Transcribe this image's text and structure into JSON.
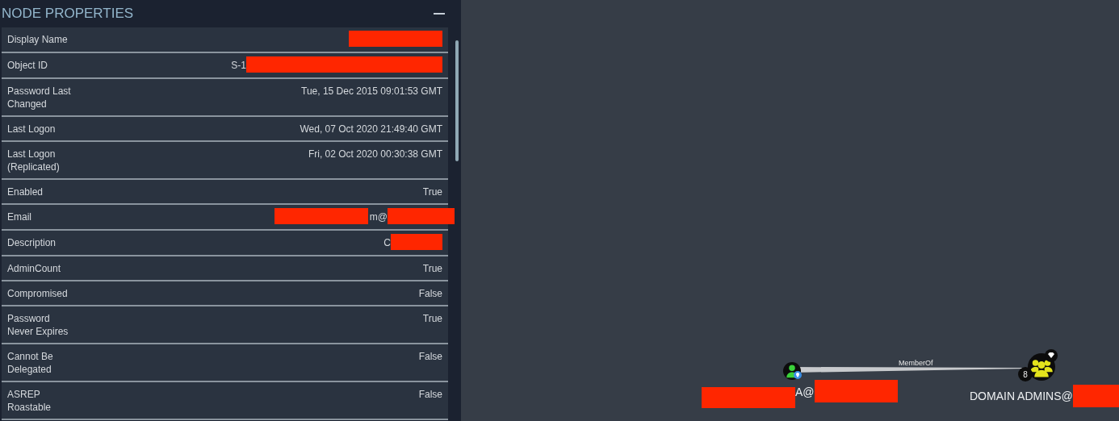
{
  "panel": {
    "title": "NODE PROPERTIES",
    "collapsed": false,
    "properties": [
      {
        "label": "Display Name",
        "redacted_after": true
      },
      {
        "label": "Object ID",
        "value": "S-1",
        "redacted_after": true
      },
      {
        "label": "Password Last Changed",
        "value": "Tue, 15 Dec 2015 09:01:53 GMT"
      },
      {
        "label": "Last Logon",
        "value": "Wed, 07 Oct 2020 21:49:40 GMT"
      },
      {
        "label": "Last Logon (Replicated)",
        "value": "Fri, 02 Oct 2020 00:30:38 GMT"
      },
      {
        "label": "Enabled",
        "value": "True"
      },
      {
        "label": "Email",
        "value": "m@",
        "redacted_before": true,
        "redacted_after": true
      },
      {
        "label": "Description",
        "value": "C",
        "redacted_after": true
      },
      {
        "label": "AdminCount",
        "value": "True"
      },
      {
        "label": "Compromised",
        "value": "False"
      },
      {
        "label": "Password Never Expires",
        "value": "True"
      },
      {
        "label": "Cannot Be Delegated",
        "value": "False"
      },
      {
        "label": "ASREP Roastable",
        "value": "False"
      }
    ]
  },
  "graph": {
    "nodes": [
      {
        "kind": "user",
        "color": "#3ad13a",
        "label": "A@",
        "redacted_before": true,
        "redacted_after": true,
        "pinned": true
      },
      {
        "kind": "group",
        "color": "#e3e31c",
        "label": "DOMAIN ADMINS@",
        "redacted_after": true,
        "high_value": true,
        "count": "8"
      }
    ],
    "edges": [
      {
        "label": "MemberOf"
      }
    ]
  }
}
